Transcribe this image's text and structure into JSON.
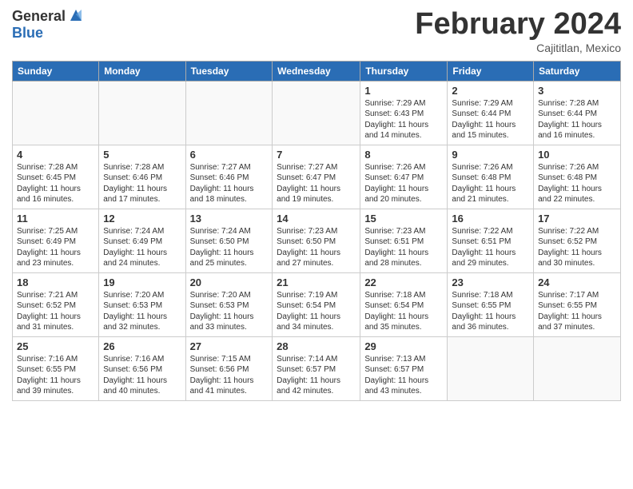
{
  "header": {
    "logo_general": "General",
    "logo_blue": "Blue",
    "month_title": "February 2024",
    "location": "Cajititlan, Mexico"
  },
  "days_of_week": [
    "Sunday",
    "Monday",
    "Tuesday",
    "Wednesday",
    "Thursday",
    "Friday",
    "Saturday"
  ],
  "weeks": [
    [
      {
        "day": "",
        "info": ""
      },
      {
        "day": "",
        "info": ""
      },
      {
        "day": "",
        "info": ""
      },
      {
        "day": "",
        "info": ""
      },
      {
        "day": "1",
        "info": "Sunrise: 7:29 AM\nSunset: 6:43 PM\nDaylight: 11 hours\nand 14 minutes."
      },
      {
        "day": "2",
        "info": "Sunrise: 7:29 AM\nSunset: 6:44 PM\nDaylight: 11 hours\nand 15 minutes."
      },
      {
        "day": "3",
        "info": "Sunrise: 7:28 AM\nSunset: 6:44 PM\nDaylight: 11 hours\nand 16 minutes."
      }
    ],
    [
      {
        "day": "4",
        "info": "Sunrise: 7:28 AM\nSunset: 6:45 PM\nDaylight: 11 hours\nand 16 minutes."
      },
      {
        "day": "5",
        "info": "Sunrise: 7:28 AM\nSunset: 6:46 PM\nDaylight: 11 hours\nand 17 minutes."
      },
      {
        "day": "6",
        "info": "Sunrise: 7:27 AM\nSunset: 6:46 PM\nDaylight: 11 hours\nand 18 minutes."
      },
      {
        "day": "7",
        "info": "Sunrise: 7:27 AM\nSunset: 6:47 PM\nDaylight: 11 hours\nand 19 minutes."
      },
      {
        "day": "8",
        "info": "Sunrise: 7:26 AM\nSunset: 6:47 PM\nDaylight: 11 hours\nand 20 minutes."
      },
      {
        "day": "9",
        "info": "Sunrise: 7:26 AM\nSunset: 6:48 PM\nDaylight: 11 hours\nand 21 minutes."
      },
      {
        "day": "10",
        "info": "Sunrise: 7:26 AM\nSunset: 6:48 PM\nDaylight: 11 hours\nand 22 minutes."
      }
    ],
    [
      {
        "day": "11",
        "info": "Sunrise: 7:25 AM\nSunset: 6:49 PM\nDaylight: 11 hours\nand 23 minutes."
      },
      {
        "day": "12",
        "info": "Sunrise: 7:24 AM\nSunset: 6:49 PM\nDaylight: 11 hours\nand 24 minutes."
      },
      {
        "day": "13",
        "info": "Sunrise: 7:24 AM\nSunset: 6:50 PM\nDaylight: 11 hours\nand 25 minutes."
      },
      {
        "day": "14",
        "info": "Sunrise: 7:23 AM\nSunset: 6:50 PM\nDaylight: 11 hours\nand 27 minutes."
      },
      {
        "day": "15",
        "info": "Sunrise: 7:23 AM\nSunset: 6:51 PM\nDaylight: 11 hours\nand 28 minutes."
      },
      {
        "day": "16",
        "info": "Sunrise: 7:22 AM\nSunset: 6:51 PM\nDaylight: 11 hours\nand 29 minutes."
      },
      {
        "day": "17",
        "info": "Sunrise: 7:22 AM\nSunset: 6:52 PM\nDaylight: 11 hours\nand 30 minutes."
      }
    ],
    [
      {
        "day": "18",
        "info": "Sunrise: 7:21 AM\nSunset: 6:52 PM\nDaylight: 11 hours\nand 31 minutes."
      },
      {
        "day": "19",
        "info": "Sunrise: 7:20 AM\nSunset: 6:53 PM\nDaylight: 11 hours\nand 32 minutes."
      },
      {
        "day": "20",
        "info": "Sunrise: 7:20 AM\nSunset: 6:53 PM\nDaylight: 11 hours\nand 33 minutes."
      },
      {
        "day": "21",
        "info": "Sunrise: 7:19 AM\nSunset: 6:54 PM\nDaylight: 11 hours\nand 34 minutes."
      },
      {
        "day": "22",
        "info": "Sunrise: 7:18 AM\nSunset: 6:54 PM\nDaylight: 11 hours\nand 35 minutes."
      },
      {
        "day": "23",
        "info": "Sunrise: 7:18 AM\nSunset: 6:55 PM\nDaylight: 11 hours\nand 36 minutes."
      },
      {
        "day": "24",
        "info": "Sunrise: 7:17 AM\nSunset: 6:55 PM\nDaylight: 11 hours\nand 37 minutes."
      }
    ],
    [
      {
        "day": "25",
        "info": "Sunrise: 7:16 AM\nSunset: 6:55 PM\nDaylight: 11 hours\nand 39 minutes."
      },
      {
        "day": "26",
        "info": "Sunrise: 7:16 AM\nSunset: 6:56 PM\nDaylight: 11 hours\nand 40 minutes."
      },
      {
        "day": "27",
        "info": "Sunrise: 7:15 AM\nSunset: 6:56 PM\nDaylight: 11 hours\nand 41 minutes."
      },
      {
        "day": "28",
        "info": "Sunrise: 7:14 AM\nSunset: 6:57 PM\nDaylight: 11 hours\nand 42 minutes."
      },
      {
        "day": "29",
        "info": "Sunrise: 7:13 AM\nSunset: 6:57 PM\nDaylight: 11 hours\nand 43 minutes."
      },
      {
        "day": "",
        "info": ""
      },
      {
        "day": "",
        "info": ""
      }
    ]
  ]
}
